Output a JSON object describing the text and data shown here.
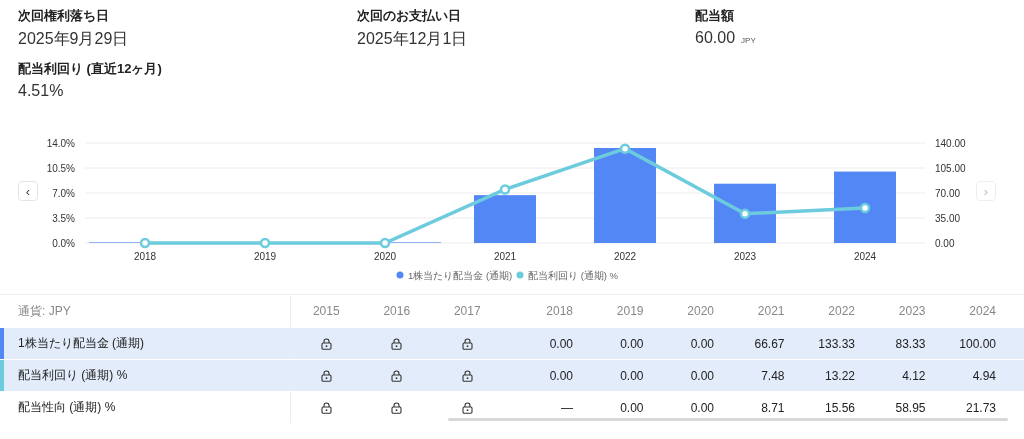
{
  "summary": [
    {
      "label": "次回権利落ち日",
      "value": "2025年9月29日"
    },
    {
      "label": "次回のお支払い日",
      "value": "2025年12月1日"
    },
    {
      "label": "配当額",
      "value": "60.00",
      "unit": "JPY"
    },
    {
      "label": "配当利回り (直近12ヶ月)",
      "value": "4.51%"
    }
  ],
  "chart": {
    "prev_button": "‹",
    "next_button": "›",
    "chart_data": {
      "type": "bar",
      "categories": [
        "2018",
        "2019",
        "2020",
        "2021",
        "2022",
        "2023",
        "2024"
      ],
      "series": [
        {
          "name": "1株当たり配当金 (通期)",
          "color": "#5287f5",
          "axis": "y2",
          "values": [
            0,
            0,
            0,
            67,
            133,
            83,
            100
          ]
        },
        {
          "name": "配当利回り (通期) %",
          "color": "#6ccbdc",
          "type": "line",
          "marker": "circle",
          "values": [
            0,
            0,
            0,
            7.5,
            13.2,
            4.1,
            4.9
          ]
        }
      ],
      "grid": true,
      "legend": "bottom",
      "ylim": [
        0,
        14
      ],
      "yticks": [
        {
          "value": 0,
          "label": "0.0%"
        },
        {
          "value": 3.5,
          "label": "3.5%"
        },
        {
          "value": 7,
          "label": "7.0%"
        },
        {
          "value": 10.5,
          "label": "10.5%"
        },
        {
          "value": 14,
          "label": "14.0%"
        }
      ],
      "y2lim": [
        0,
        140
      ],
      "y2ticks": [
        {
          "value": 0,
          "label": "0.00"
        },
        {
          "value": 35,
          "label": "35.00"
        },
        {
          "value": 70,
          "label": "70.00"
        },
        {
          "value": 105,
          "label": "105.00"
        },
        {
          "value": 140,
          "label": "140.00"
        }
      ]
    }
  },
  "table": {
    "corner": "通貨: JPY",
    "columns": [
      "2015",
      "2016",
      "2017",
      "2018",
      "2019",
      "2020",
      "2021",
      "2022",
      "2023",
      "2024"
    ],
    "rows": [
      {
        "label": "1株当たり配当金 (通期)",
        "selected": true,
        "color": "#5287f5",
        "cells": [
          {
            "kind": "locked"
          },
          {
            "kind": "locked"
          },
          {
            "kind": "locked"
          },
          {
            "kind": "text",
            "text": "0.00"
          },
          {
            "kind": "text",
            "text": "0.00"
          },
          {
            "kind": "text",
            "text": "0.00"
          },
          {
            "kind": "text",
            "text": "66.67"
          },
          {
            "kind": "text",
            "text": "133.33"
          },
          {
            "kind": "text",
            "text": "83.33"
          },
          {
            "kind": "text",
            "text": "100.00"
          }
        ]
      },
      {
        "label": "配当利回り (通期) %",
        "selected": true,
        "color": "#6ccbdc",
        "cells": [
          {
            "kind": "locked"
          },
          {
            "kind": "locked"
          },
          {
            "kind": "locked"
          },
          {
            "kind": "text",
            "text": "0.00"
          },
          {
            "kind": "text",
            "text": "0.00"
          },
          {
            "kind": "text",
            "text": "0.00"
          },
          {
            "kind": "text",
            "text": "7.48"
          },
          {
            "kind": "text",
            "text": "13.22"
          },
          {
            "kind": "text",
            "text": "4.12"
          },
          {
            "kind": "text",
            "text": "4.94"
          }
        ]
      },
      {
        "label": "配当性向 (通期) %",
        "selected": false,
        "cells": [
          {
            "kind": "locked"
          },
          {
            "kind": "locked"
          },
          {
            "kind": "locked"
          },
          {
            "kind": "text",
            "text": "—"
          },
          {
            "kind": "text",
            "text": "0.00"
          },
          {
            "kind": "text",
            "text": "0.00"
          },
          {
            "kind": "text",
            "text": "8.71"
          },
          {
            "kind": "text",
            "text": "15.56"
          },
          {
            "kind": "text",
            "text": "58.95"
          },
          {
            "kind": "text",
            "text": "21.73"
          }
        ]
      }
    ]
  }
}
